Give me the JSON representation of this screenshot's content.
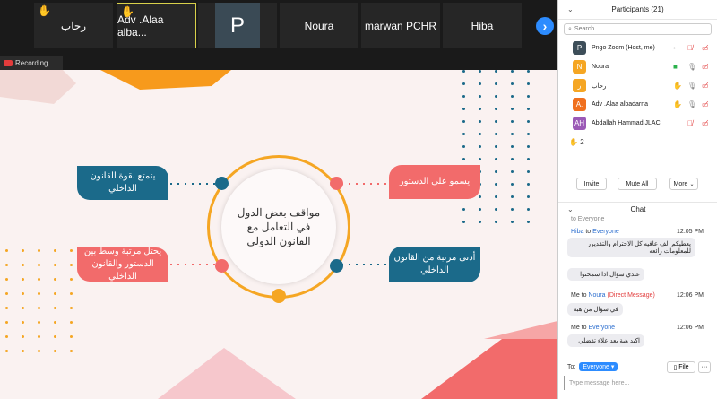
{
  "strip": {
    "tiles": [
      "رحاب",
      "Adv .Alaa alba...",
      "P",
      "Noura",
      "marwan PCHR",
      "Hiba"
    ],
    "next_icon": "›"
  },
  "recording": "Recording...",
  "slide": {
    "center": "مواقف بعض الدول في التعامل مع القانون الدولي",
    "left_top": "يتمتع بقوة القانون الداخلي",
    "left_bottom": "يحتل مرتبة وسط بين الدستور والقانون الداخلي",
    "right_top": "يسمو على الدستور",
    "right_bottom": "أدنى مرتبة من القانون الداخلي"
  },
  "participants": {
    "title": "Participants (21)",
    "search_placeholder": "Search",
    "rows": [
      {
        "initial": "P",
        "name": "Pngo Zoom (Host, me)",
        "color": "#3d4e59"
      },
      {
        "initial": "N",
        "name": "Noura",
        "color": "#f5a623"
      },
      {
        "initial": "ر",
        "name": "رحاب",
        "color": "#f5a623"
      },
      {
        "initial": "A.",
        "name": "Adv .Alaa albadarna",
        "color": "#f0701e"
      },
      {
        "initial": "AH",
        "name": "Abdallah Hammad  JLAC",
        "color": "#9b59b6"
      }
    ],
    "hands_count": "2",
    "invite": "Invite",
    "mute_all": "Mute All",
    "more": "More"
  },
  "chat": {
    "title": "Chat",
    "from_partial": "to Everyone",
    "messages": [
      {
        "sender": "Hiba",
        "to": "to",
        "recipient": "Everyone",
        "time": "12:05 PM",
        "texts": [
          "يعطيكم الف عافيه كل الاحترام والتقديرر للمعلومات رائعه",
          "عندي سؤال اذا سمحتوا"
        ]
      },
      {
        "sender": "Me",
        "to": "to",
        "recipient": "Noura",
        "dm": "(Direct Message)",
        "time": "12:06 PM",
        "texts": [
          "في سؤال من هبة"
        ]
      },
      {
        "sender": "Me",
        "to": "to",
        "recipient": "Everyone",
        "time": "12:06 PM",
        "texts": [
          "اكيد هبة بعد علاء تفضلي"
        ]
      }
    ],
    "to_label": "To:",
    "to_value": "Everyone",
    "file": "File",
    "more": "···",
    "input_placeholder": "Type message here..."
  }
}
